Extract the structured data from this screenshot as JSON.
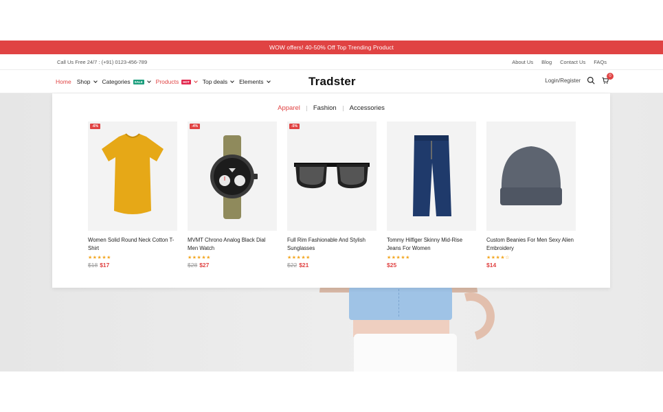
{
  "promo": {
    "text": "WOW offers! 40-50% Off Top Trending Product"
  },
  "topbar": {
    "call": "Call Us Free 24/7 : (+91) 0123-456-789",
    "links": [
      "About Us",
      "Blog",
      "Contact Us",
      "FAQs"
    ]
  },
  "nav": {
    "home": "Home",
    "shop": "Shop",
    "categories": "Categories",
    "categories_badge": "SALE",
    "products": "Products",
    "products_badge": "HOT",
    "top_deals": "Top deals",
    "elements": "Elements",
    "logo": "Tradster",
    "login": "Login/Register",
    "cart_count": "0"
  },
  "mega": {
    "tabs": [
      "Apparel",
      "Fashion",
      "Accessories"
    ],
    "products": [
      {
        "name": "Women Solid Round Neck Cotton T-Shirt",
        "discount": "-6%",
        "stars": "★★★★★",
        "old_price": "$18",
        "price": "$17"
      },
      {
        "name": "MVMT Chrono Analog Black Dial Men Watch",
        "discount": "-4%",
        "stars": "★★★★★",
        "old_price": "$28",
        "price": "$27"
      },
      {
        "name": "Full Rim Fashionable And Stylish Sunglasses",
        "discount": "-5%",
        "stars": "★★★★★",
        "old_price": "$22",
        "price": "$21"
      },
      {
        "name": "Tommy Hilfiger Skinny Mid-Rise Jeans For Women",
        "discount": "",
        "stars": "★★★★★",
        "old_price": "",
        "price": "$25"
      },
      {
        "name": "Custom Beanies For Men Sexy Alien Embroidery",
        "discount": "",
        "stars": "★★★★☆",
        "old_price": "",
        "price": "$14"
      }
    ]
  },
  "colors": {
    "accent": "#e04343",
    "sale_badge": "#1a9e7c",
    "hot_badge": "#e2264d",
    "star": "#f3a825"
  }
}
